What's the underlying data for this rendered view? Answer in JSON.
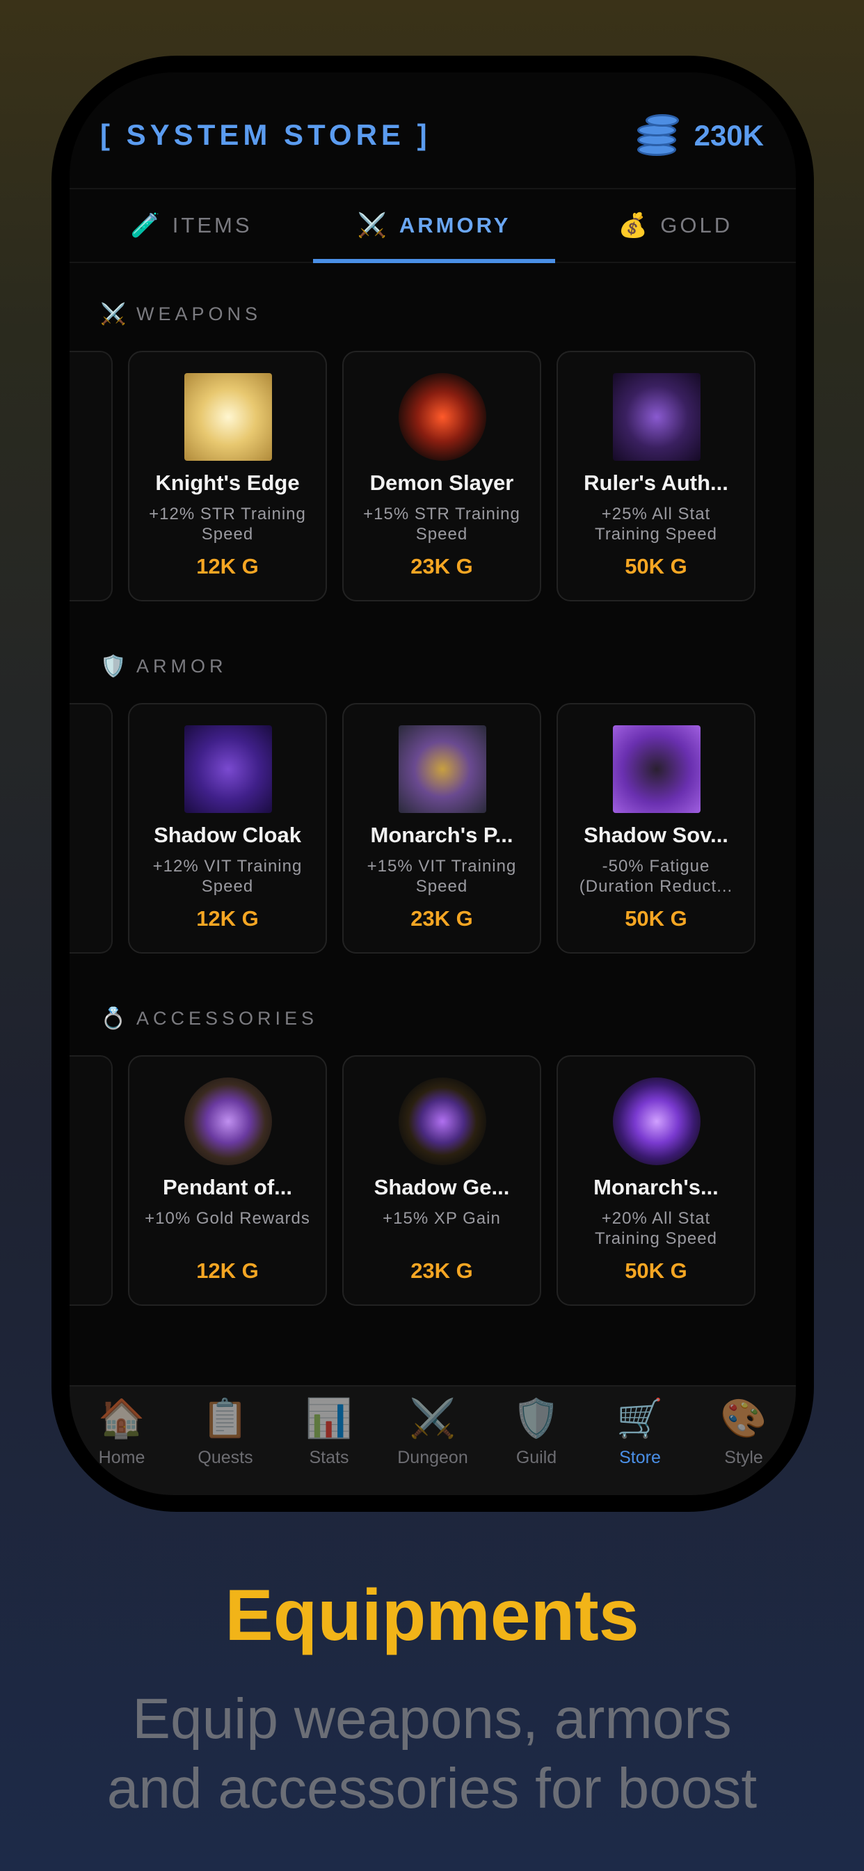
{
  "header": {
    "title": "[ SYSTEM STORE ]",
    "balance": "230K",
    "balance_icon": "coins-icon"
  },
  "tabs": [
    {
      "icon": "🧪",
      "label": "ITEMS",
      "active": false
    },
    {
      "icon": "⚔️",
      "label": "ARMORY",
      "active": true
    },
    {
      "icon": "💰",
      "label": "GOLD",
      "active": false
    }
  ],
  "sections": [
    {
      "icon": "⚔️",
      "label": "WEAPONS",
      "items": [
        {
          "name": "Knight's Edge",
          "desc": "+12% STR Training Speed",
          "price": "12K G"
        },
        {
          "name": "Demon Slayer",
          "desc": "+15% STR Training Speed",
          "price": "23K G"
        },
        {
          "name": "Ruler's Auth...",
          "desc": "+25% All Stat Training Speed",
          "price": "50K G"
        }
      ]
    },
    {
      "icon": "🛡️",
      "label": "ARMOR",
      "items": [
        {
          "name": "Shadow Cloak",
          "desc": "+12% VIT Training Speed",
          "price": "12K G"
        },
        {
          "name": "Monarch's P...",
          "desc": "+15% VIT Training Speed",
          "price": "23K G"
        },
        {
          "name": "Shadow Sov...",
          "desc": "-50% Fatigue (Duration Reduct...",
          "price": "50K G"
        }
      ]
    },
    {
      "icon": "💍",
      "label": "ACCESSORIES",
      "items": [
        {
          "name": "Pendant of...",
          "desc": "+10% Gold Rewards",
          "price": "12K G"
        },
        {
          "name": "Shadow Ge...",
          "desc": "+15% XP Gain",
          "price": "23K G"
        },
        {
          "name": "Monarch's...",
          "desc": "+20% All Stat Training Speed",
          "price": "50K G"
        }
      ]
    }
  ],
  "nav": [
    {
      "icon": "🏠",
      "label": "Home"
    },
    {
      "icon": "📋",
      "label": "Quests"
    },
    {
      "icon": "📊",
      "label": "Stats"
    },
    {
      "icon": "⚔️",
      "label": "Dungeon"
    },
    {
      "icon": "🛡️",
      "label": "Guild"
    },
    {
      "icon": "🛒",
      "label": "Store",
      "active": true
    },
    {
      "icon": "🎨",
      "label": "Style"
    }
  ],
  "promo": {
    "headline": "Equipments",
    "subline_1": "Equip weapons, armors",
    "subline_2": "and accessories for boost"
  },
  "colors": {
    "accent": "#4a8fe6",
    "price": "#f5a623",
    "headline": "#f2b418"
  }
}
